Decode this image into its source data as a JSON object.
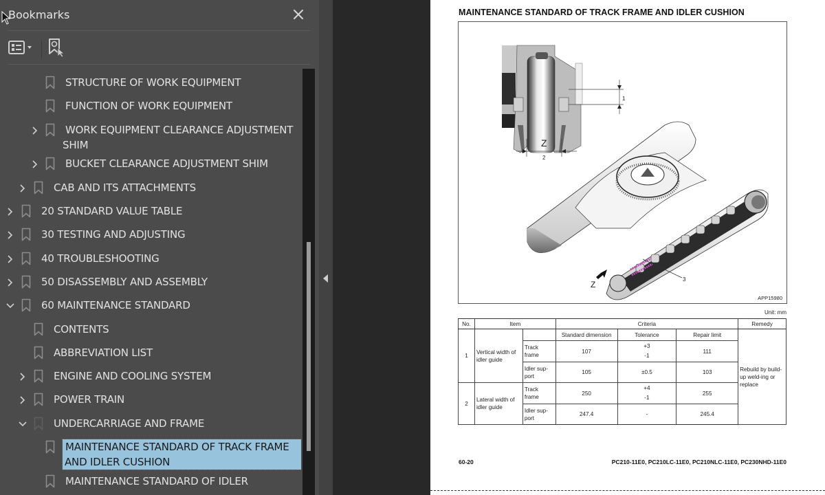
{
  "bookmarks_panel": {
    "title": "Bookmarks",
    "close_icon": "close-icon",
    "toolbar": {
      "options_icon": "list-options-icon",
      "find_current_icon": "find-current-bookmark-icon"
    },
    "items": [
      {
        "label": "STRUCTURE OF WORK EQUIPMENT",
        "level": 3,
        "expandable": false,
        "expanded": false,
        "selected": false
      },
      {
        "label": "FUNCTION OF WORK EQUIPMENT",
        "level": 3,
        "expandable": false,
        "expanded": false,
        "selected": false
      },
      {
        "label": "WORK EQUIPMENT CLEARANCE ADJUSTMENT SHIM",
        "level": 3,
        "expandable": true,
        "expanded": false,
        "selected": false
      },
      {
        "label": "BUCKET CLEARANCE ADJUSTMENT SHIM",
        "level": 3,
        "expandable": true,
        "expanded": false,
        "selected": false
      },
      {
        "label": "CAB AND ITS ATTACHMENTS",
        "level": 2,
        "expandable": true,
        "expanded": false,
        "selected": false
      },
      {
        "label": "20 STANDARD VALUE TABLE",
        "level": 1,
        "expandable": true,
        "expanded": false,
        "selected": false
      },
      {
        "label": "30 TESTING AND ADJUSTING",
        "level": 1,
        "expandable": true,
        "expanded": false,
        "selected": false
      },
      {
        "label": "40 TROUBLESHOOTING",
        "level": 1,
        "expandable": true,
        "expanded": false,
        "selected": false
      },
      {
        "label": "50 DISASSEMBLY AND ASSEMBLY",
        "level": 1,
        "expandable": true,
        "expanded": false,
        "selected": false
      },
      {
        "label": "60 MAINTENANCE STANDARD",
        "level": 1,
        "expandable": true,
        "expanded": true,
        "selected": false
      },
      {
        "label": "CONTENTS",
        "level": 2,
        "expandable": false,
        "expanded": false,
        "selected": false
      },
      {
        "label": "ABBREVIATION LIST",
        "level": 2,
        "expandable": false,
        "expanded": false,
        "selected": false
      },
      {
        "label": "ENGINE AND COOLING SYSTEM",
        "level": 2,
        "expandable": true,
        "expanded": false,
        "selected": false
      },
      {
        "label": "POWER TRAIN",
        "level": 2,
        "expandable": true,
        "expanded": false,
        "selected": false
      },
      {
        "label": "UNDERCARRIAGE AND FRAME",
        "level": 2,
        "expandable": true,
        "expanded": true,
        "selected": false
      },
      {
        "label": "MAINTENANCE STANDARD OF TRACK FRAME AND IDLER CUSHION",
        "level": 3,
        "expandable": false,
        "expanded": false,
        "selected": true
      },
      {
        "label": "MAINTENANCE STANDARD OF IDLER",
        "level": 3,
        "expandable": false,
        "expanded": false,
        "selected": false
      }
    ],
    "selected_highlight_color": "#98c3dd"
  },
  "splitter": {
    "collapse_icon": "collapse-left-arrow-icon"
  },
  "document": {
    "title": "MAINTENANCE STANDARD OF TRACK FRAME AND IDLER CUSHION",
    "figure": {
      "id": "APP15980",
      "callouts": [
        "1",
        "2",
        "3"
      ],
      "view_label": "Z"
    },
    "unit_label": "Unit: mm",
    "table": {
      "headers": {
        "no": "No.",
        "item": "Item",
        "criteria": "Criteria",
        "remedy": "Remedy",
        "standard_dimension": "Standard dimension",
        "tolerance": "Tolerance",
        "repair_limit": "Repair limit"
      },
      "groups": [
        {
          "no": "1",
          "item": "Vertical width of idler guide",
          "rows": [
            {
              "sub": "Track frame",
              "standard": "107",
              "tolerance_plus": "+3",
              "tolerance_minus": "-1",
              "tolerance": "",
              "repair_limit": "111"
            },
            {
              "sub": "Idler sup-port",
              "standard": "105",
              "tolerance_plus": "",
              "tolerance_minus": "",
              "tolerance": "±0.5",
              "repair_limit": "103"
            }
          ]
        },
        {
          "no": "2",
          "item": "Lateral width of idler guide",
          "rows": [
            {
              "sub": "Track frame",
              "standard": "250",
              "tolerance_plus": "+4",
              "tolerance_minus": "-1",
              "tolerance": "",
              "repair_limit": "255"
            },
            {
              "sub": "Idler sup-port",
              "standard": "247.4",
              "tolerance_plus": "",
              "tolerance_minus": "",
              "tolerance": "-",
              "repair_limit": "245.4"
            }
          ]
        }
      ],
      "remedy": "Rebuild by build-up weld-ing or replace"
    },
    "footer": {
      "page_number": "60-20",
      "models": "PC210-11E0, PC210LC-11E0, PC210NLC-11E0, PC230NHD-11E0"
    }
  }
}
